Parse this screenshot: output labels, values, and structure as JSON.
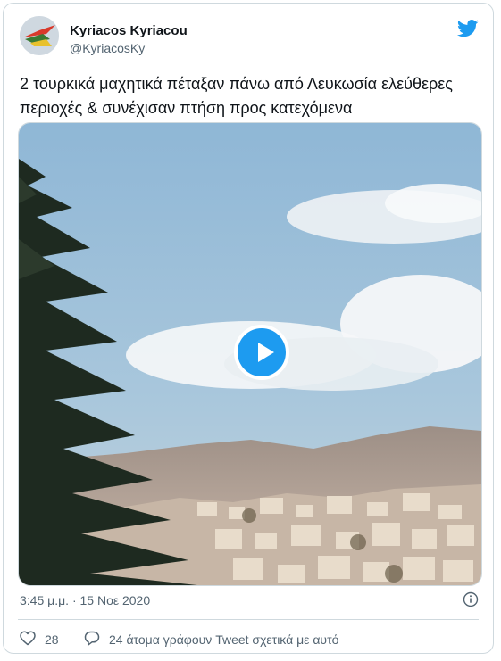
{
  "tweet": {
    "author_name": "Kyriacos Kyriacou",
    "author_handle": "@KyriacosKy",
    "text": "2 τουρκικά μαχητικά πέταξαν πάνω από Λευκωσία ελεύθερες περιοχές & συνέχισαν πτήση προς κατεχόμενα",
    "timestamp": "3:45 μ.μ. · 15 Νοε 2020",
    "like_count": "28",
    "reply_label": "24 άτομα γράφουν Tweet σχετικά με αυτό"
  },
  "icons": {
    "brand": "twitter-bird-icon",
    "media_action": "play-icon",
    "info": "info-icon",
    "like": "heart-icon",
    "reply": "speech-bubble-icon"
  },
  "colors": {
    "accent": "#1d9bf0",
    "text_primary": "#0f1419",
    "text_secondary": "#536471",
    "border": "#cfd9de"
  }
}
